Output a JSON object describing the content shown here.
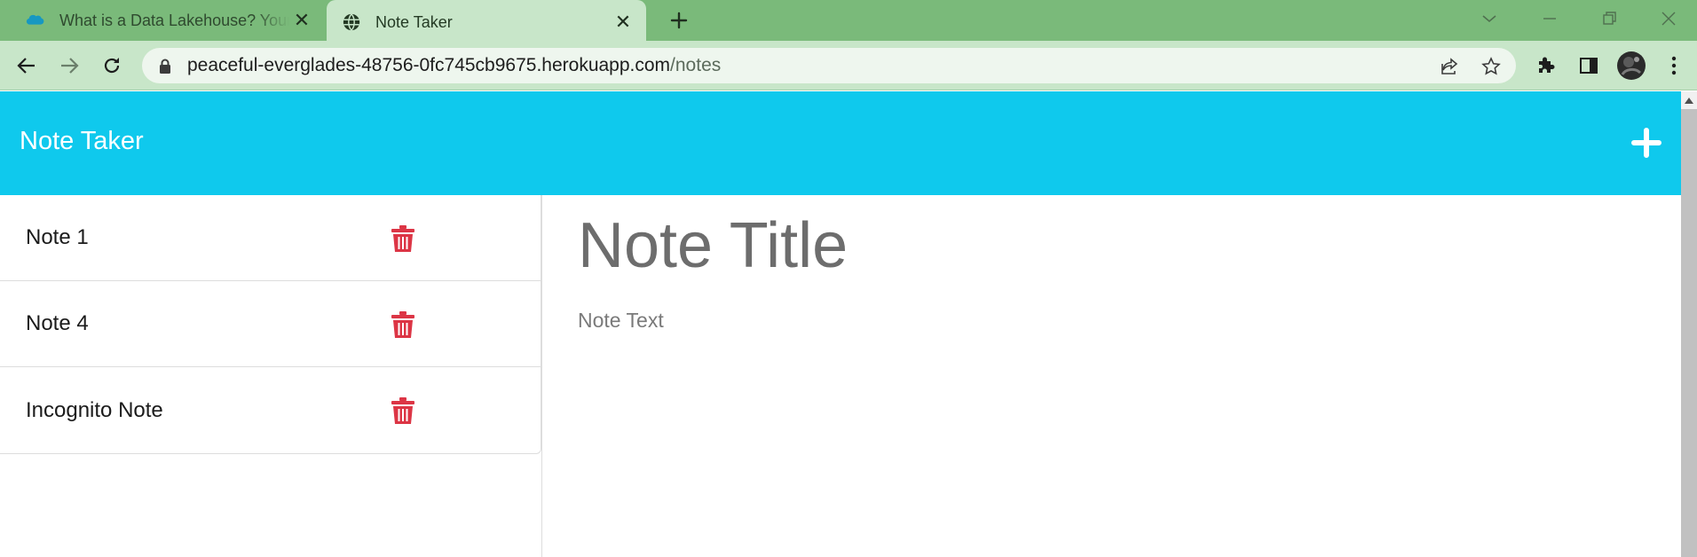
{
  "browser": {
    "tabs": [
      {
        "title": "What is a Data Lakehouse? Your Data Lakehouse Guide",
        "active": false,
        "favicon": "salesforce-cloud-icon"
      },
      {
        "title": "Note Taker",
        "active": true,
        "favicon": "globe-icon"
      }
    ],
    "tab_close_glyph": "✕",
    "url_host": "peaceful-everglades-48756-0fc745cb9675.herokuapp.com",
    "url_path": "/notes",
    "colors": {
      "tabstrip": "#7aba7a",
      "toolbar": "#c8e6c9"
    }
  },
  "app": {
    "brand": "Note Taker",
    "colors": {
      "navbar": "#0fc9ed",
      "delete": "#dc3545"
    }
  },
  "notes": [
    {
      "label": "Note 1"
    },
    {
      "label": "Note 4"
    },
    {
      "label": "Incognito Note"
    }
  ],
  "editor": {
    "title_placeholder": "Note Title",
    "text_placeholder": "Note Text"
  }
}
